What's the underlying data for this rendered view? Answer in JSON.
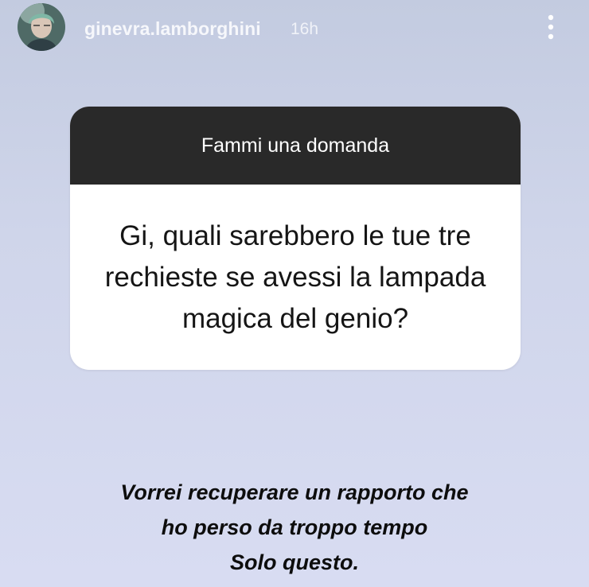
{
  "story": {
    "username": "ginevra.lamborghini",
    "time": "16h",
    "avatar_icon": "profile-photo",
    "menu_icon": "more-vertical-icon"
  },
  "question_sticker": {
    "prompt": "Fammi una domanda",
    "question": "Gi, quali sarebbero le tue tre rechieste se avessi la lampada magica del genio?"
  },
  "answer": {
    "lines": [
      "Vorrei recuperare un rapporto che",
      "ho perso da troppo tempo",
      "Solo questo."
    ]
  },
  "colors": {
    "header_bar": "#292929",
    "card_bg": "#ffffff",
    "background_top": "#c3cbe0",
    "background_bottom": "#d8dcf2"
  }
}
